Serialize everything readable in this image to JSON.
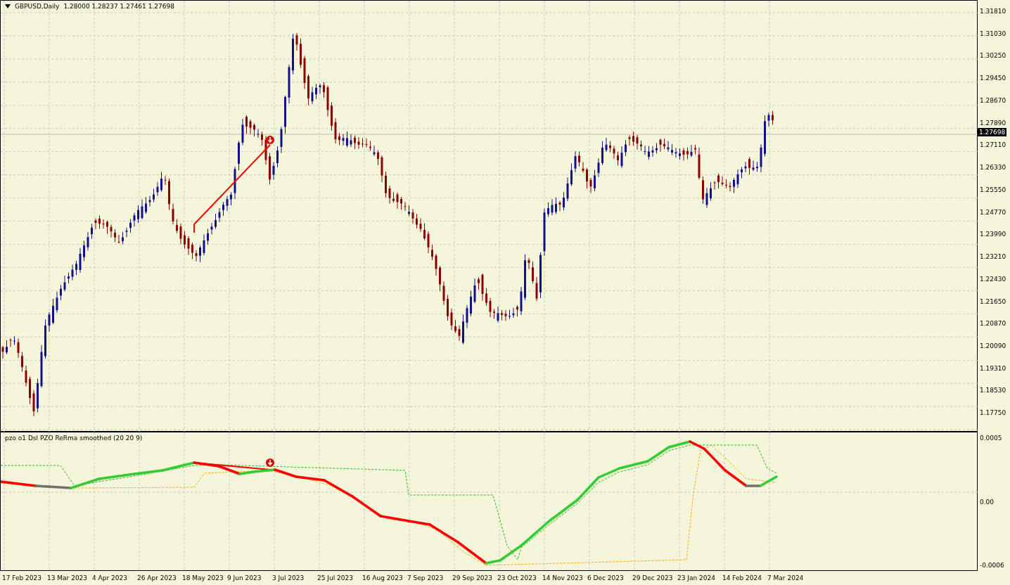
{
  "header": {
    "symbol": "GBPUSD,Daily",
    "ohlc": "1.28000 1.28237 1.27461 1.27698"
  },
  "price_axis": [
    "1.31810",
    "1.31030",
    "1.30250",
    "1.29450",
    "1.28670",
    "1.27890",
    "1.27110",
    "1.26330",
    "1.25550",
    "1.24770",
    "1.23990",
    "1.23210",
    "1.22430",
    "1.21650",
    "1.20870",
    "1.20090",
    "1.19310",
    "1.18530",
    "1.17750"
  ],
  "current_price": "1.27698",
  "indicator": {
    "title": "pzo o1 Dsl PZO ReRma smoothed (20 20 9)",
    "axis": [
      "0.0005",
      "0.00",
      "-0.0006"
    ]
  },
  "time_axis": [
    "17 Feb 2023",
    "13 Mar 2023",
    "4 Apr 2023",
    "26 Apr 2023",
    "18 May 2023",
    "9 Jun 2023",
    "3 Jul 2023",
    "25 Jul 2023",
    "16 Aug 2023",
    "7 Sep 2023",
    "29 Sep 2023",
    "23 Oct 2023",
    "14 Nov 2023",
    "6 Dec 2023",
    "29 Dec 2023",
    "23 Jan 2024",
    "14 Feb 2024",
    "7 Mar 2024"
  ]
}
